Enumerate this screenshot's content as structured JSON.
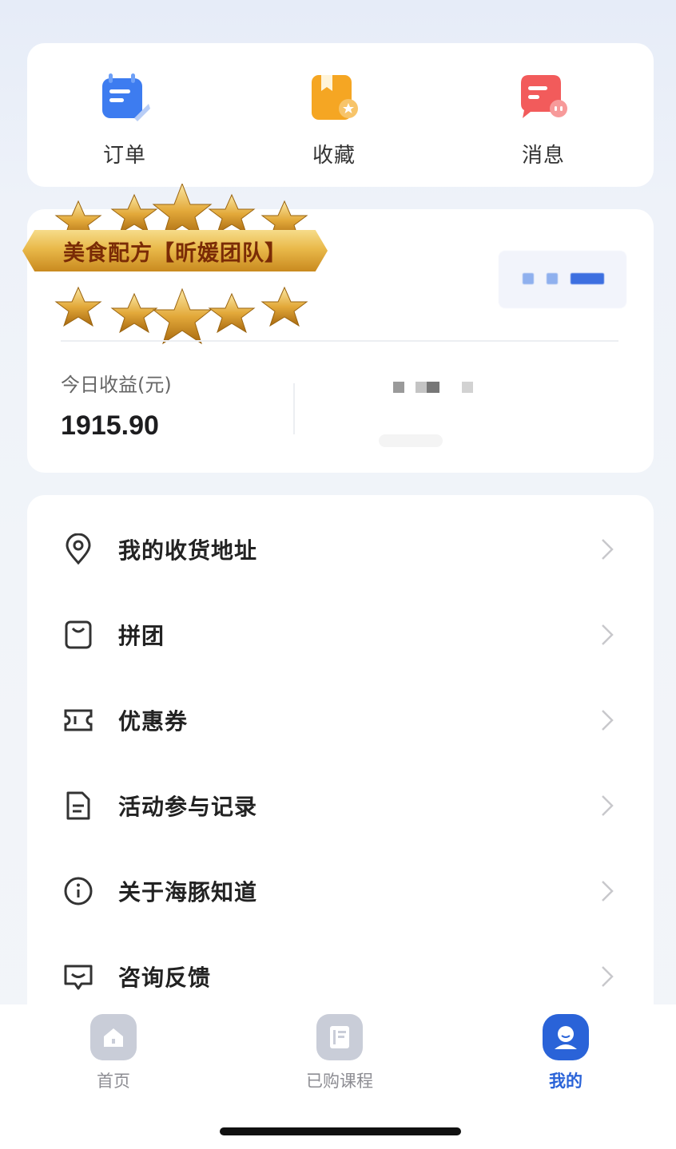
{
  "quick_actions": [
    {
      "label": "订单",
      "icon": "order-icon",
      "color": "#3d7cf0"
    },
    {
      "label": "收藏",
      "icon": "favorites-icon",
      "color": "#f5a623"
    },
    {
      "label": "消息",
      "icon": "message-icon",
      "color": "#f25b5b"
    }
  ],
  "badge": {
    "text": "美食配方【昕媛团队】"
  },
  "earnings": {
    "label": "今日收益(元)",
    "value": "1915.90"
  },
  "menu": [
    {
      "label": "我的收货地址",
      "icon": "location-pin-icon"
    },
    {
      "label": "拼团",
      "icon": "shopping-bag-icon"
    },
    {
      "label": "优惠券",
      "icon": "coupon-icon"
    },
    {
      "label": "活动参与记录",
      "icon": "document-icon"
    },
    {
      "label": "关于海豚知道",
      "icon": "info-icon"
    },
    {
      "label": "咨询反馈",
      "icon": "chat-icon"
    }
  ],
  "tabs": [
    {
      "label": "首页",
      "icon": "home-icon",
      "active": false
    },
    {
      "label": "已购课程",
      "icon": "book-icon",
      "active": false
    },
    {
      "label": "我的",
      "icon": "profile-icon",
      "active": true
    }
  ],
  "colors": {
    "accent": "#2a63d8",
    "gold": "#e9b94a"
  }
}
